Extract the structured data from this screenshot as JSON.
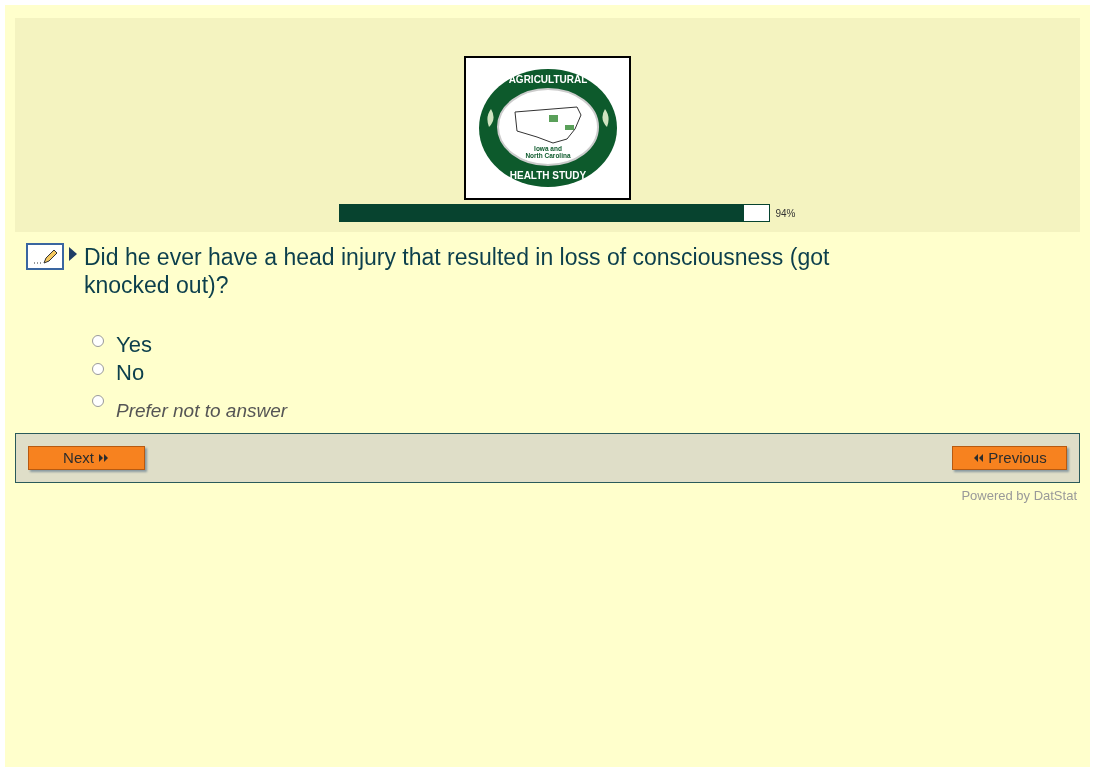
{
  "header": {
    "logo": {
      "top_text": "AGRICULTURAL",
      "bottom_text": "HEALTH STUDY",
      "inner_lines": [
        "Iowa and",
        "North Carolina"
      ]
    },
    "progress": {
      "level": 0.94,
      "reading": "94%"
    }
  },
  "question": {
    "text": "Did he ever have a head injury that resulted in loss of consciousness (got knocked out)?",
    "options": [
      {
        "label": "Yes",
        "kind": "answer",
        "selected": false
      },
      {
        "label": "No",
        "kind": "answer",
        "selected": false
      },
      {
        "label": "Prefer not to answer",
        "kind": "decline",
        "selected": false
      }
    ]
  },
  "navigation": {
    "next": "Next",
    "previous": "Previous"
  },
  "footer": "Powered by DatStat"
}
